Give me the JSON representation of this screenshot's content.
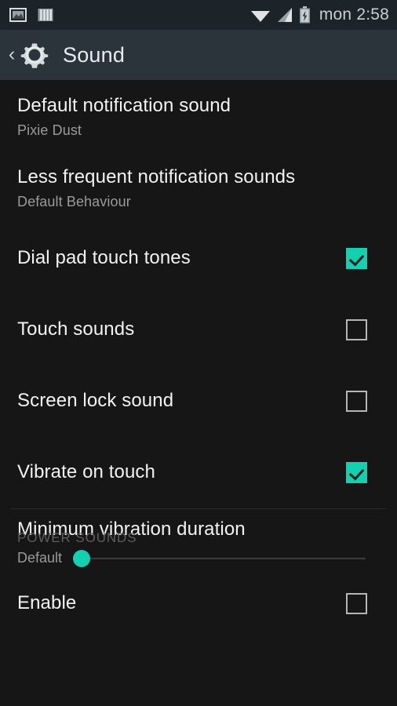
{
  "status_bar": {
    "left_icons": [
      {
        "name": "photo-icon",
        "label": "photo"
      },
      {
        "name": "bars-icon",
        "label": "bars"
      }
    ],
    "right_icons": [
      {
        "name": "wifi-icon",
        "label": "wifi"
      },
      {
        "name": "cellular-signal-icon",
        "label": "signal"
      },
      {
        "name": "battery-charging-icon",
        "label": "battery charging"
      }
    ],
    "clock": "mon 2:58",
    "background_color": "#1c242a"
  },
  "action_bar": {
    "back_label": "‹",
    "icon": "settings-gear-icon",
    "title": "Sound",
    "background_color": "#2b343a"
  },
  "theme": {
    "accent_color": "#12d0b0",
    "content_background": "#161616",
    "primary_text": "#f2f2f2",
    "secondary_text": "#9a9a9a",
    "section_header_text": "#5e5e5e",
    "checkbox_border": "#b6b6b6"
  },
  "settings": {
    "default_notification_sound": {
      "title": "Default notification sound",
      "summary": "Pixie Dust"
    },
    "less_frequent_notification_sounds": {
      "title": "Less frequent notification sounds",
      "summary": "Default Behaviour"
    },
    "dial_pad_touch_tones": {
      "title": "Dial pad touch tones",
      "checked": true
    },
    "touch_sounds": {
      "title": "Touch sounds",
      "checked": false
    },
    "screen_lock_sound": {
      "title": "Screen lock sound",
      "checked": false
    },
    "vibrate_on_touch": {
      "title": "Vibrate on touch",
      "checked": true
    },
    "minimum_vibration_duration": {
      "title": "Minimum vibration duration",
      "value_label": "Default",
      "slider_position_percent": 0
    }
  },
  "power_sounds_section": {
    "header": "POWER SOUNDS",
    "enable": {
      "title": "Enable",
      "checked": false
    }
  }
}
